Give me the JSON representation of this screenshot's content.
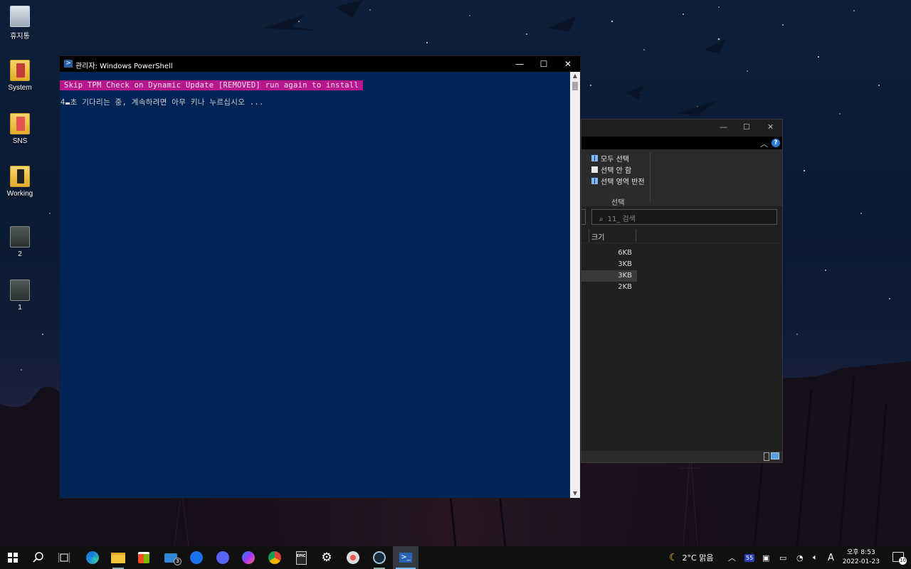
{
  "desktop": {
    "icons": [
      {
        "label": "휴지통",
        "icon": "recycle-bin-icon"
      },
      {
        "label": "System",
        "icon": "folder-icon"
      },
      {
        "label": "SNS",
        "icon": "folder-icon"
      },
      {
        "label": "Working",
        "icon": "folder-icon"
      },
      {
        "label": "2",
        "icon": "image-file-icon"
      },
      {
        "label": "1",
        "icon": "image-file-icon"
      }
    ]
  },
  "powershell": {
    "title": "관리자: Windows PowerShell",
    "minimize": "—",
    "maximize": "☐",
    "close": "✕",
    "line1": "Skip TPM Check on Dynamic Update [REMOVED] run again to install",
    "line2_prefix": "4",
    "line2_rest": "초 기다리는 중, 계속하려면 아무 키나 누르십시오 ...",
    "highlight_color": "#b9178e",
    "background_color": "#012456"
  },
  "explorer": {
    "select_all": "모두 선택",
    "select_none": "선택 안 함",
    "invert_selection": "선택 영역 반전",
    "group_label": "선택",
    "search_placeholder": "11_ 검색",
    "col_size": "크기",
    "sizes": [
      "6KB",
      "3KB",
      "3KB",
      "2KB"
    ],
    "help": "?"
  },
  "taskbar": {
    "apps": [
      "start-icon",
      "search-icon",
      "task-view-icon",
      "edge-icon",
      "file-explorer-icon",
      "store-icon",
      "mail-icon",
      "teamviewer-icon",
      "discord-icon",
      "messenger-icon",
      "chrome-icon",
      "epic-games-icon",
      "settings-icon",
      "gpu-icon",
      "steam-icon",
      "powershell-icon"
    ],
    "mail_badge": "3",
    "epic_label": "EPIC",
    "weather": "2°C 맑음",
    "tray_badge": "55",
    "ime": "A",
    "time": "오후 8:53",
    "date": "2022-01-23",
    "notifications": "10"
  }
}
